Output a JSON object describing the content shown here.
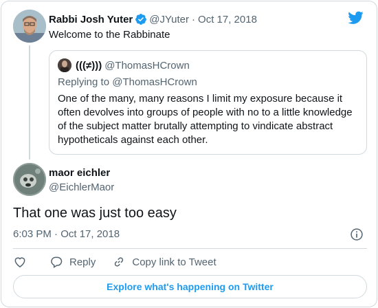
{
  "parent_tweet": {
    "author_name": "Rabbi Josh Yuter",
    "handle": "@JYuter",
    "separator": "·",
    "date": "Oct 17, 2018",
    "text": "Welcome to the Rabbinate",
    "verified_icon": "verified-badge-icon"
  },
  "quoted_tweet": {
    "author_name": "(((≠)))",
    "handle": "@ThomasHCrown",
    "replying_to_label": "Replying to",
    "replying_to_handle": "@ThomasHCrown",
    "text": "One of the many, many reasons I limit my exposure because it often devolves into groups of people with no to a little knowledge of the subject matter brutally attempting to vindicate abstract hypotheticals against each other."
  },
  "main_tweet": {
    "author_name": "maor eichler",
    "handle": "@EichlerMaor",
    "text": "That one was just too easy",
    "timestamp": "6:03 PM · Oct 17, 2018"
  },
  "actions": {
    "like_icon": "heart-icon",
    "reply_label": "Reply",
    "copy_label": "Copy link to Tweet"
  },
  "explore_label": "Explore what's happening on Twitter",
  "colors": {
    "brand": "#1d9bf0",
    "text": "#0f1419",
    "muted": "#536471",
    "border": "#cfd9de"
  }
}
